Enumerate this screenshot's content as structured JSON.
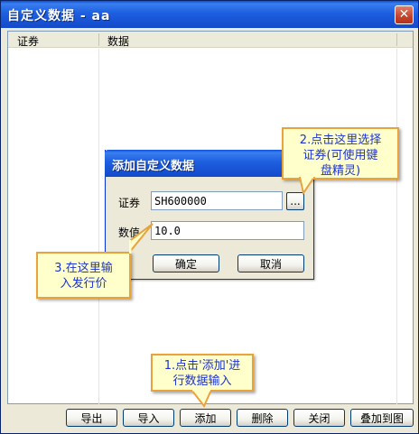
{
  "window": {
    "title": "自定义数据  -  aa",
    "close_symbol": "✕"
  },
  "list": {
    "columns": [
      "证券",
      "数据"
    ]
  },
  "toolbar": {
    "export_label": "导出",
    "import_label": "导入",
    "add_label": "添加",
    "delete_label": "删除",
    "close_label": "关闭",
    "overlay_label": "叠加到图"
  },
  "dialog": {
    "title": "添加自定义数据",
    "security_label": "证券",
    "security_value": "SH600000",
    "browse_label": "...",
    "value_label": "数值",
    "value_value": "10.0",
    "ok_label": "确定",
    "cancel_label": "取消"
  },
  "callouts": {
    "step1_line1": "1.点击'添加'进",
    "step1_line2": "行数据输入",
    "step2_line1": "2.点击这里选择",
    "step2_line2": "证券(可使用键",
    "step2_line3": "盘精灵)",
    "step3_line1": "3.在这里输",
    "step3_line2": "入发行价"
  },
  "colors": {
    "titlebar": "#1d5fe0",
    "callout_bg": "#ffffcc",
    "callout_border": "#e8a33c",
    "callout_text": "#1c33d0"
  }
}
